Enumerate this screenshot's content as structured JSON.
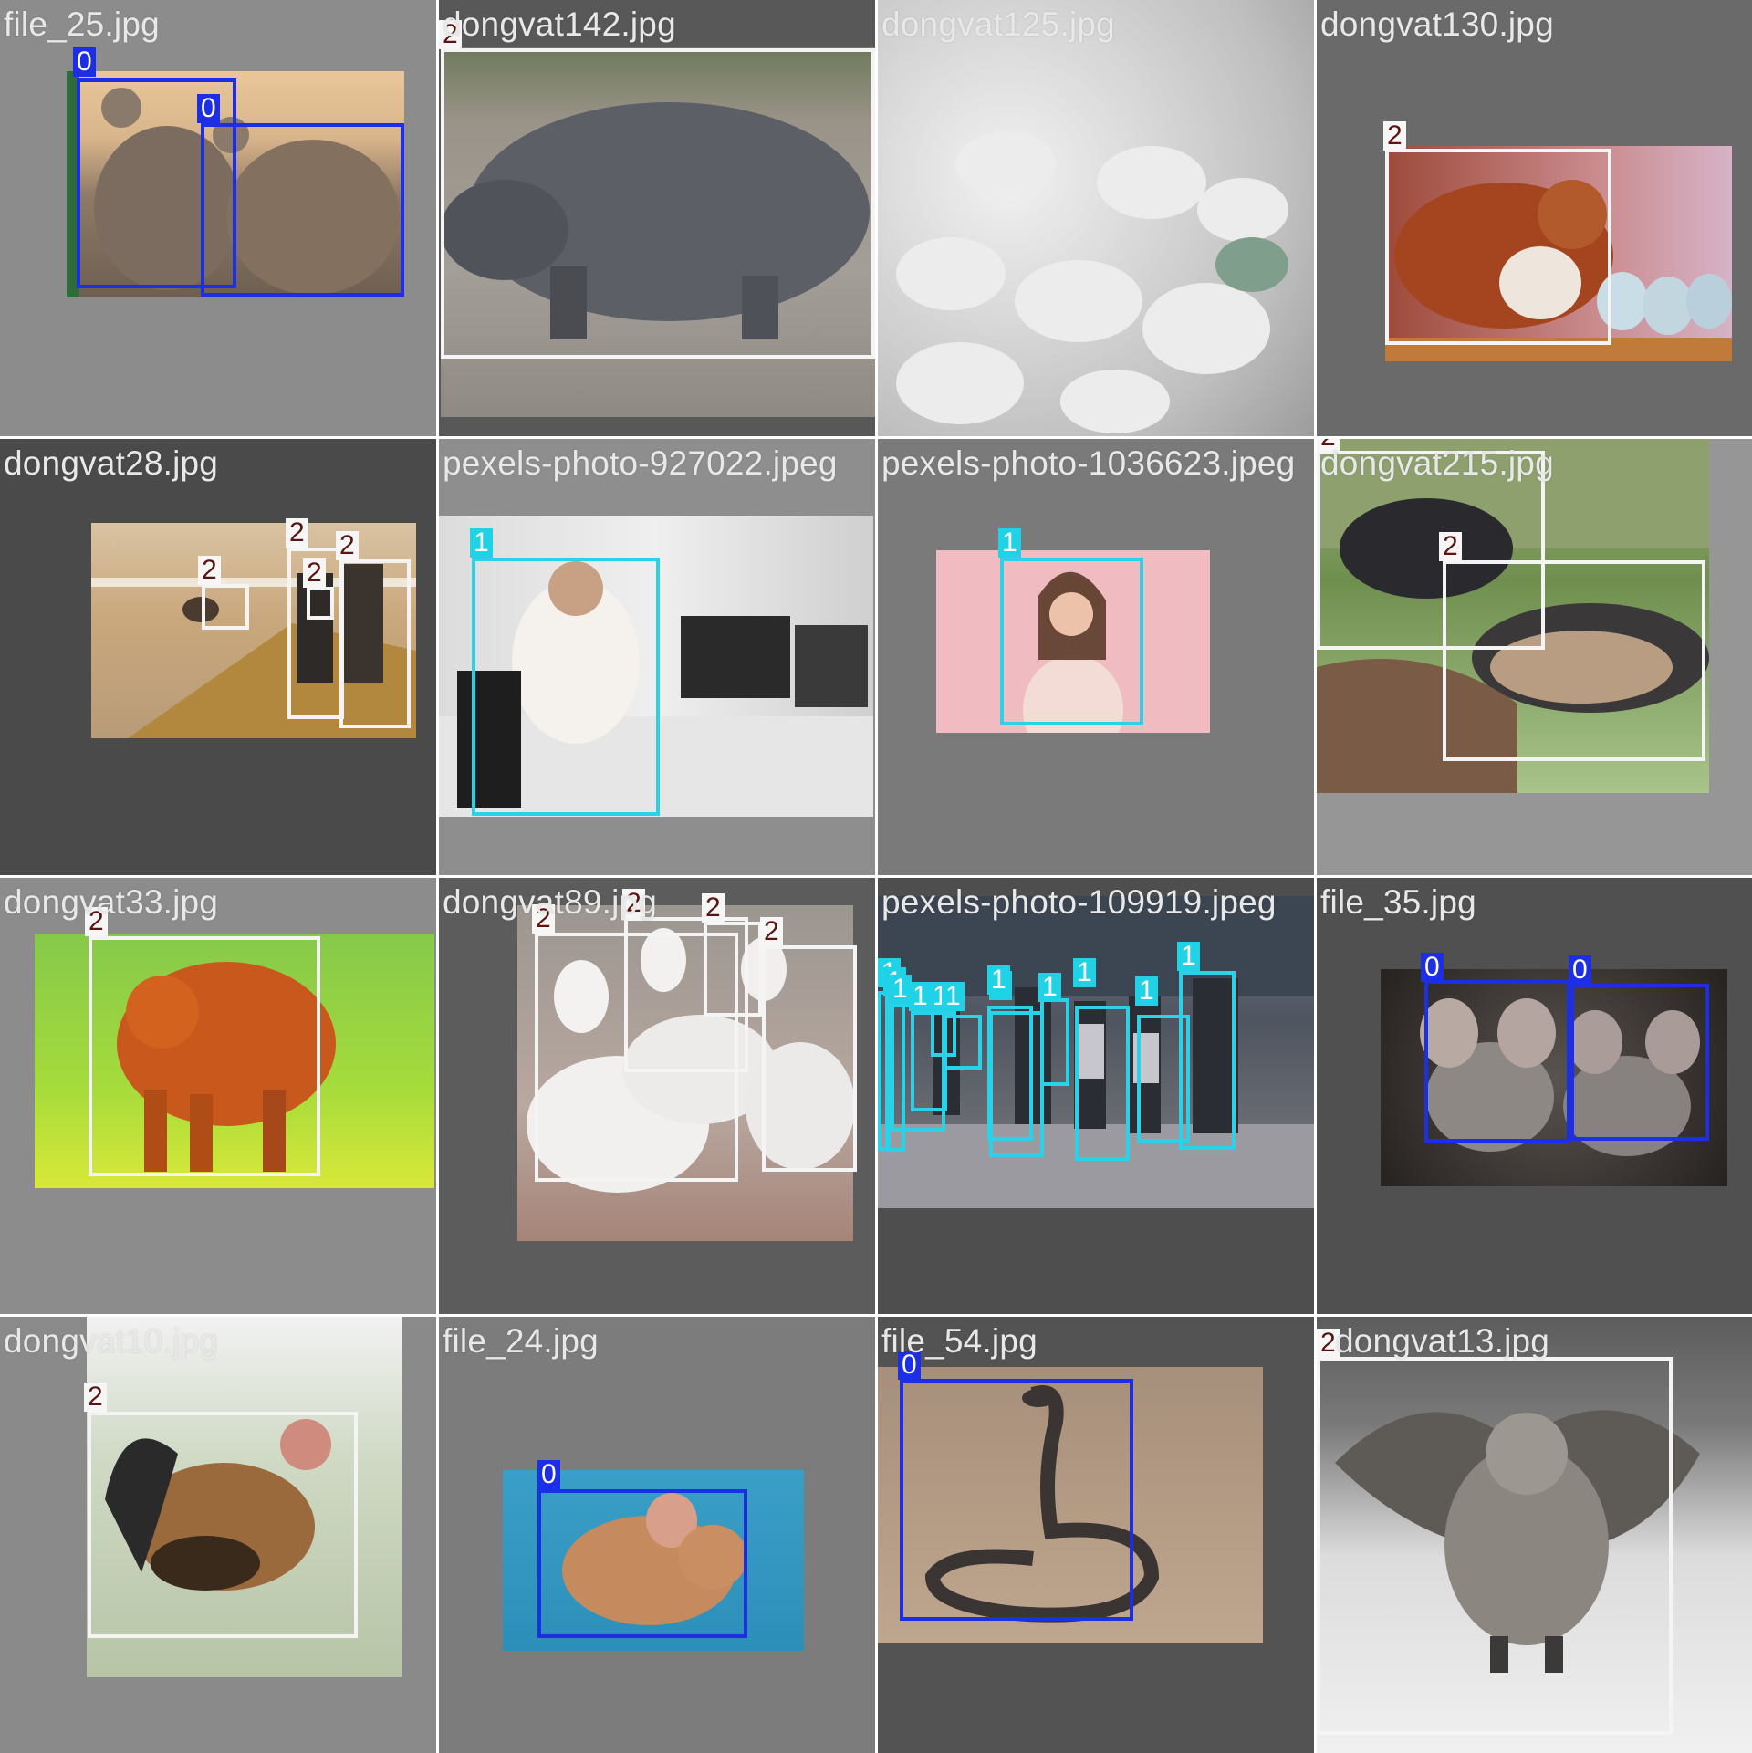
{
  "colors": {
    "class_0": "#1c2ee6",
    "class_1": "#2bd1e6",
    "class_2": "#f4f4f4"
  },
  "tiles": [
    {
      "filename": "file_25.jpg",
      "background": "#8c8c8c",
      "labels": [
        "0",
        "0"
      ],
      "scene": "two-rats"
    },
    {
      "filename": "dongvat142.jpg",
      "background": "#585858",
      "labels": [
        "2"
      ],
      "scene": "pig"
    },
    {
      "filename": "dongvat125.jpg",
      "background": "#9a9a9a",
      "labels": [],
      "scene": "duck-flock"
    },
    {
      "filename": "dongvat130.jpg",
      "background": "#6a6a6a",
      "labels": [
        "2"
      ],
      "scene": "quail"
    },
    {
      "filename": "dongvat28.jpg",
      "background": "#4a4a4a",
      "labels": [
        "2",
        "2",
        "2",
        "2"
      ],
      "scene": "cow-barn"
    },
    {
      "filename": "pexels-photo-927022.jpeg",
      "background": "#8e8e8e",
      "labels": [
        "1"
      ],
      "scene": "office-man"
    },
    {
      "filename": "pexels-photo-1036623.jpeg",
      "background": "#7a7a7a",
      "labels": [
        "1"
      ],
      "scene": "woman-pink"
    },
    {
      "filename": "dongvat215.jpg",
      "background": "#969696",
      "labels": [
        "2",
        "2"
      ],
      "scene": "goats"
    },
    {
      "filename": "dongvat33.jpg",
      "background": "#8c8c8c",
      "labels": [
        "2"
      ],
      "scene": "orange-cow"
    },
    {
      "filename": "dongvat89.jpg",
      "background": "#5c5c5c",
      "labels": [
        "2",
        "2",
        "2",
        "2"
      ],
      "scene": "white-geese"
    },
    {
      "filename": "pexels-photo-109919.jpeg",
      "background": "#4e4e4e",
      "labels": [
        "1",
        "1",
        "1",
        "1",
        "1",
        "1",
        "1",
        "1",
        "1",
        "1",
        "1",
        "1"
      ],
      "scene": "crowd"
    },
    {
      "filename": "file_35.jpg",
      "background": "#505050",
      "labels": [
        "0",
        "0"
      ],
      "scene": "two-mice"
    },
    {
      "filename": "dongvat10.jpg",
      "background": "#8a8a8a",
      "labels": [
        "2"
      ],
      "scene": "rooster"
    },
    {
      "filename": "file_24.jpg",
      "background": "#7c7c7c",
      "labels": [
        "0"
      ],
      "scene": "mouse-blue"
    },
    {
      "filename": "file_54.jpg",
      "background": "#535353",
      "labels": [
        "0"
      ],
      "scene": "cobra"
    },
    {
      "filename": "dongvat13.jpg",
      "background": "#828282",
      "labels": [
        "2"
      ],
      "scene": "owl"
    }
  ]
}
